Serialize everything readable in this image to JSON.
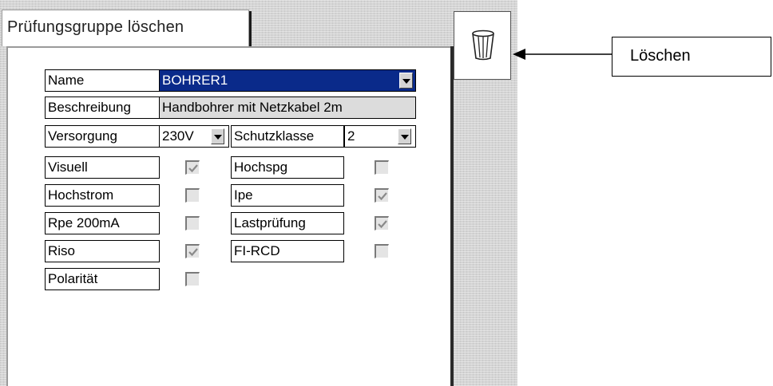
{
  "tab": {
    "title": "Prüfungsgruppe löschen"
  },
  "form": {
    "name_label": "Name",
    "name_value": "BOHRER1",
    "description_label": "Beschreibung",
    "description_value": "Handbohrer mit Netzkabel 2m",
    "supply_label": "Versorgung",
    "supply_value": "230V",
    "class_label": "Schutzklasse",
    "class_value": "2",
    "tests_left": [
      {
        "label": "Visuell",
        "checked": true
      },
      {
        "label": "Hochstrom",
        "checked": false
      },
      {
        "label": "Rpe 200mA",
        "checked": false
      },
      {
        "label": "Riso",
        "checked": true
      },
      {
        "label": "Polarität",
        "checked": false
      }
    ],
    "tests_right": [
      {
        "label": "Hochspg",
        "checked": false
      },
      {
        "label": "Ipe",
        "checked": true
      },
      {
        "label": "Lastprüfung",
        "checked": true
      },
      {
        "label": "FI-RCD",
        "checked": false
      }
    ]
  },
  "callout": {
    "label": "Löschen"
  },
  "icons": {
    "delete_button": "trash-icon",
    "callout_pointer": "arrow-left-icon"
  }
}
